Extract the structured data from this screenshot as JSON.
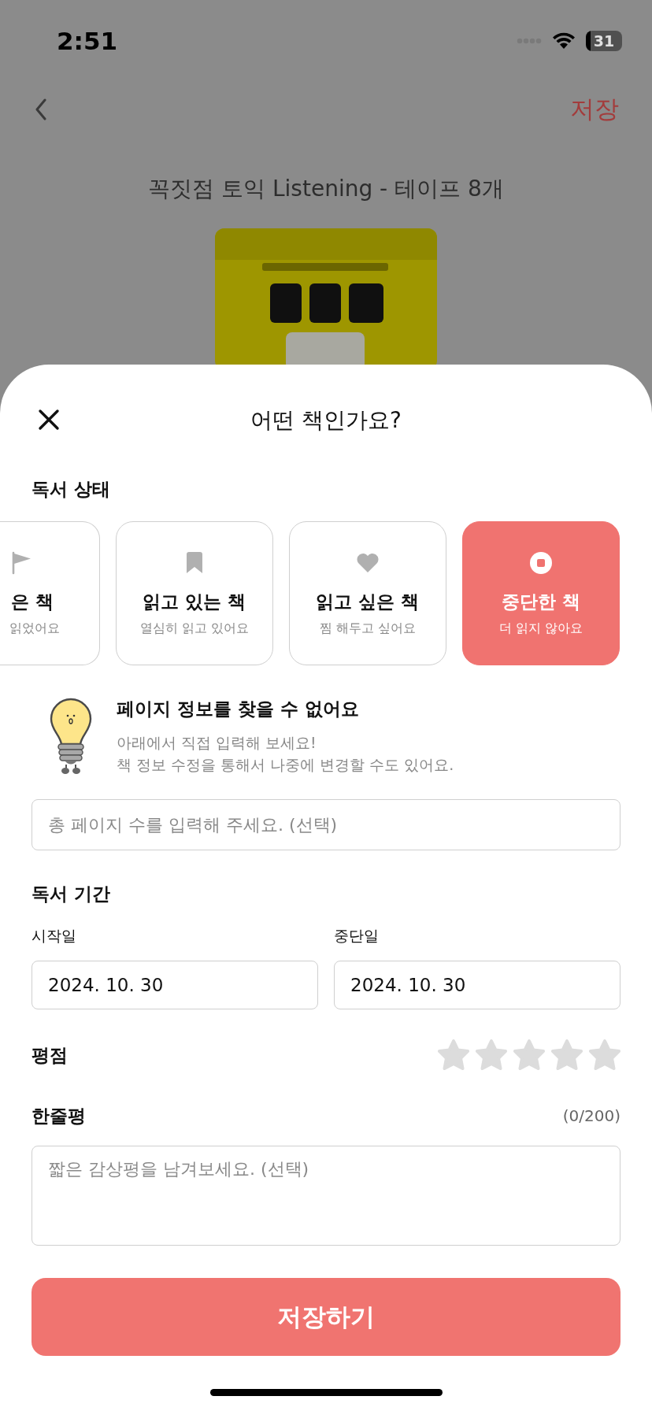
{
  "status_bar": {
    "time": "2:51",
    "battery": "31"
  },
  "nav": {
    "save": "저장"
  },
  "book": {
    "title": "꼭짓점 토익 Listening - 테이프 8개"
  },
  "sheet": {
    "title": "어떤 책인가요?",
    "reading_status": {
      "label": "독서 상태",
      "options": [
        {
          "kind": "flag",
          "title": "은 책",
          "subtitle": "읽었어요",
          "selected": false
        },
        {
          "kind": "bookmark",
          "title": "읽고 있는 책",
          "subtitle": "열심히 읽고 있어요",
          "selected": false
        },
        {
          "kind": "heart",
          "title": "읽고 싶은 책",
          "subtitle": "찜 해두고 싶어요",
          "selected": false
        },
        {
          "kind": "stop",
          "title": "중단한 책",
          "subtitle": "더 읽지 않아요",
          "selected": true
        }
      ]
    },
    "page_notice": {
      "title": "페이지 정보를 찾을 수 없어요",
      "lines": [
        "아래에서 직접 입력해 보세요!",
        "책 정보 수정을 통해서 나중에 변경할 수도 있어요."
      ]
    },
    "page_field": {
      "placeholder": "총 페이지 수를 입력해 주세요. (선택)"
    },
    "period": {
      "label": "독서 기간",
      "fields": [
        {
          "label": "시작일",
          "value": "2024. 10. 30"
        },
        {
          "label": "중단일",
          "value": "2024. 10. 30"
        }
      ]
    },
    "rating": {
      "label": "평점",
      "stars": 0
    },
    "review": {
      "label": "한줄평",
      "count": "(0/200)",
      "placeholder": "짧은 감상평을 남겨보세요. (선택)"
    },
    "save_button": "저장하기"
  }
}
